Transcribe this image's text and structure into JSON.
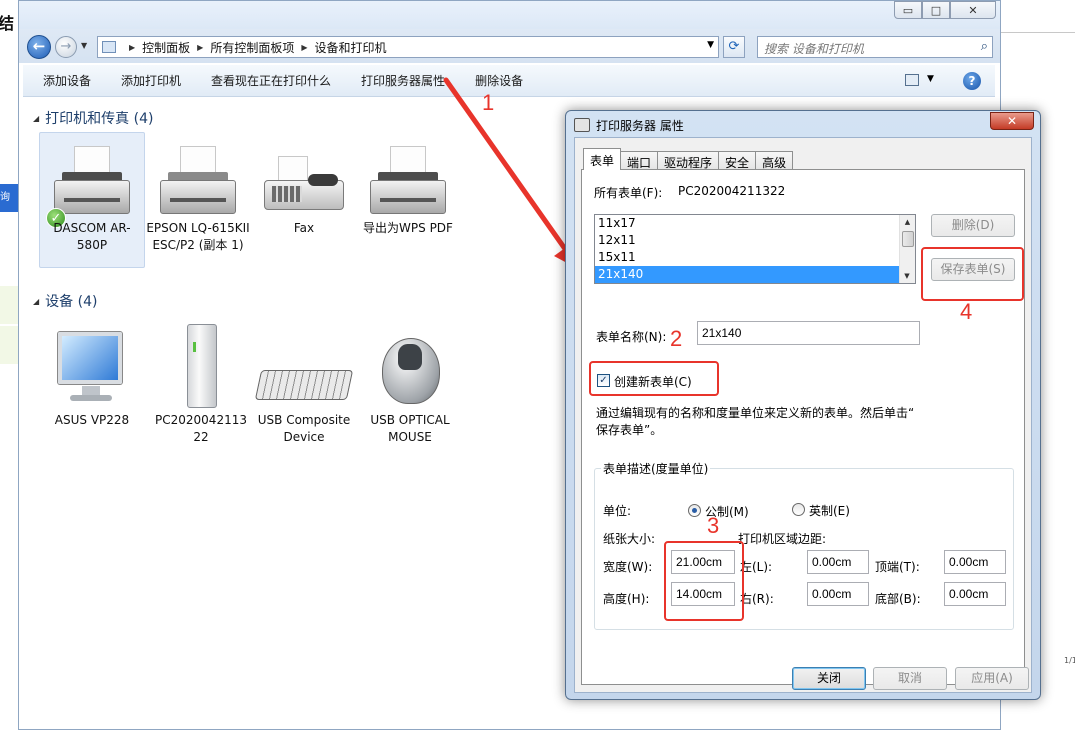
{
  "background": {
    "left_title": "结",
    "left_blue_text": "询",
    "right_page_text": "1/1"
  },
  "window": {
    "caption_buttons": {
      "minimize": "▭",
      "maximize": "□",
      "close": "✕"
    },
    "breadcrumb": [
      "控制面板",
      "所有控制面板项",
      "设备和打印机"
    ],
    "search_placeholder": "搜索 设备和打印机",
    "toolbar": [
      "添加设备",
      "添加打印机",
      "查看现在正在打印什么",
      "打印服务器属性",
      "删除设备"
    ],
    "help": "?"
  },
  "sections": {
    "printers": {
      "title": "打印机和传真 (4)"
    },
    "devices": {
      "title": "设备 (4)"
    }
  },
  "printers": [
    {
      "label": "DASCOM AR-580P",
      "icon": "printer-icon",
      "default": true
    },
    {
      "label": "EPSON LQ-615KII ESC/P2 (副本 1)",
      "icon": "printer-icon"
    },
    {
      "label": "Fax",
      "icon": "fax-icon"
    },
    {
      "label": "导出为WPS PDF",
      "icon": "printer-icon"
    }
  ],
  "devices": [
    {
      "label": "ASUS VP228",
      "icon": "monitor-icon"
    },
    {
      "label": "PC202004211322",
      "icon": "computer-icon"
    },
    {
      "label": "USB Composite Device",
      "icon": "keyboard-icon"
    },
    {
      "label": "USB OPTICAL MOUSE",
      "icon": "mouse-icon"
    }
  ],
  "annotations": {
    "n1": "1",
    "n2": "2",
    "n3": "3",
    "n4": "4",
    "color": "#e8342b"
  },
  "dialog": {
    "title": "打印服务器 属性",
    "close": "✕",
    "tabs": [
      "表单",
      "端口",
      "驱动程序",
      "安全",
      "高级"
    ],
    "all_forms_label": "所有表单(F):",
    "server_name": "PC202004211322",
    "forms": [
      "11x17",
      "12x11",
      "15x11",
      "21x140"
    ],
    "selected_form": "21x140",
    "delete_button": "删除(D)",
    "save_button": "保存表单(S)",
    "form_name_label": "表单名称(N):",
    "form_name_value": "21x140",
    "create_new_label": "创建新表单(C)",
    "create_new_checked": true,
    "description_line1": "通过编辑现有的名称和度量单位来定义新的表单。然后单击“",
    "description_line2": "保存表单”。",
    "group_title": "表单描述(度量单位)",
    "unit_label": "单位:",
    "unit_metric": "公制(M)",
    "unit_imperial": "英制(E)",
    "paper_size_label": "纸张大小:",
    "margins_label": "打印机区域边距:",
    "width_label": "宽度(W):",
    "width_value": "21.00cm",
    "height_label": "高度(H):",
    "height_value": "14.00cm",
    "left_label": "左(L):",
    "left_value": "0.00cm",
    "right_label": "右(R):",
    "right_value": "0.00cm",
    "top_label": "顶端(T):",
    "top_value": "0.00cm",
    "bottom_label": "底部(B):",
    "bottom_value": "0.00cm",
    "ok_button": "关闭",
    "cancel_button": "取消",
    "apply_button": "应用(A)"
  }
}
